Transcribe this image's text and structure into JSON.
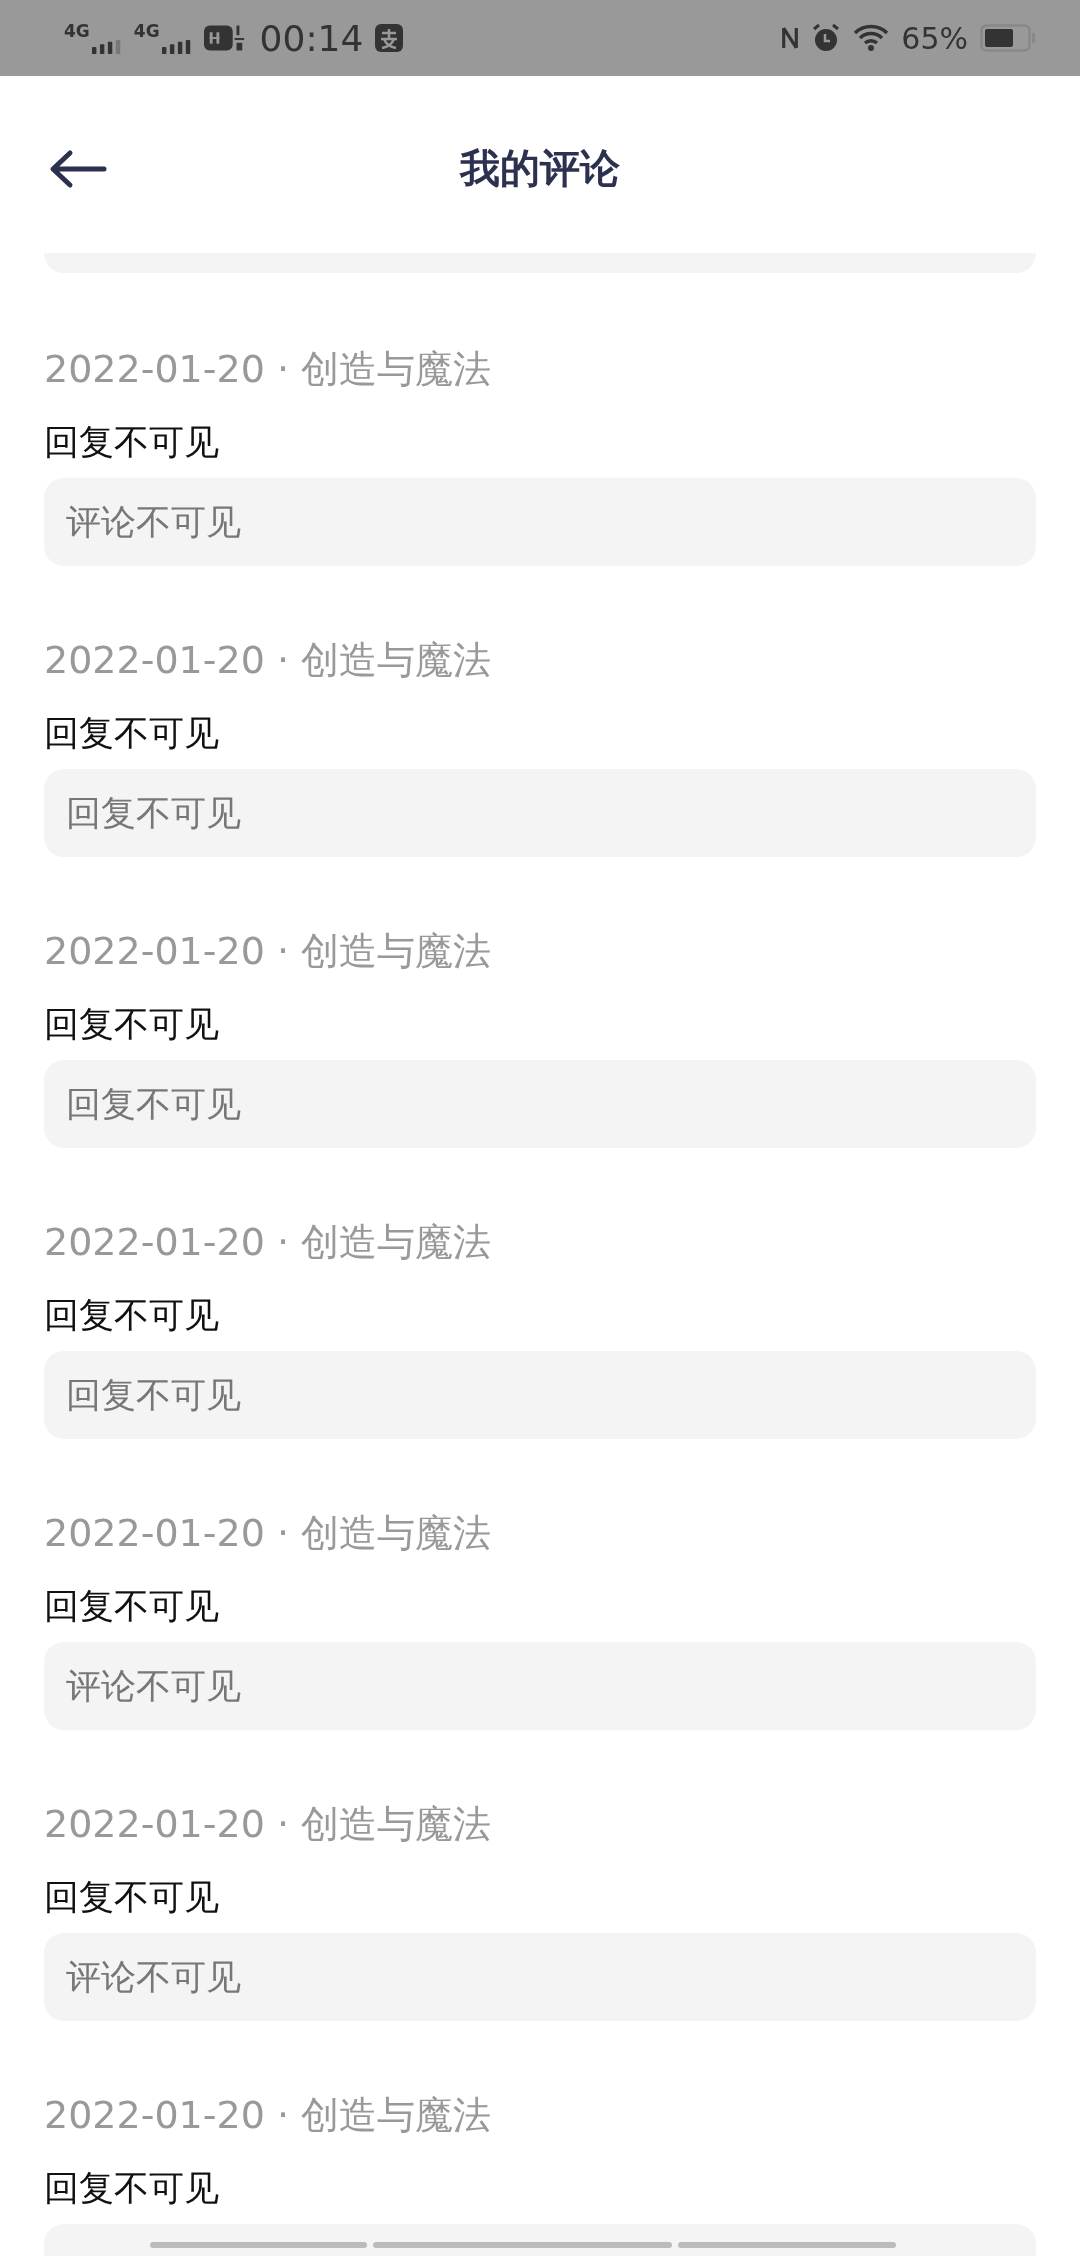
{
  "status_bar": {
    "sim_labels": [
      "4G",
      "4G"
    ],
    "time": "00:14",
    "battery": "65%"
  },
  "header": {
    "title": "我的评论"
  },
  "items": [
    {
      "meta": "2022-01-20 · 创造与魔法",
      "reply": "回复不可见",
      "quoted": "评论不可见"
    },
    {
      "meta": "2022-01-20 · 创造与魔法",
      "reply": "回复不可见",
      "quoted": "回复不可见"
    },
    {
      "meta": "2022-01-20 · 创造与魔法",
      "reply": "回复不可见",
      "quoted": "回复不可见"
    },
    {
      "meta": "2022-01-20 · 创造与魔法",
      "reply": "回复不可见",
      "quoted": "回复不可见"
    },
    {
      "meta": "2022-01-20 · 创造与魔法",
      "reply": "回复不可见",
      "quoted": "评论不可见"
    },
    {
      "meta": "2022-01-20 · 创造与魔法",
      "reply": "回复不可见",
      "quoted": "评论不可见"
    },
    {
      "meta": "2022-01-20 · 创造与魔法",
      "reply": "回复不可见"
    }
  ]
}
